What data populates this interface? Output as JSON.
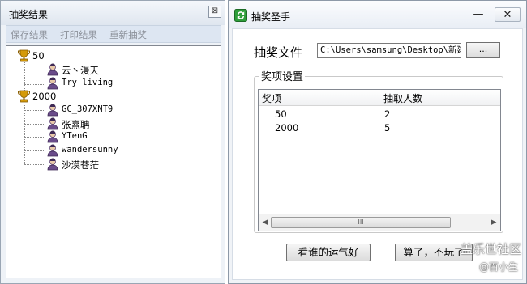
{
  "results_window": {
    "title": "抽奖结果",
    "close_glyph": "⊠",
    "menu": [
      "保存结果",
      "打印结果",
      "重新抽奖"
    ],
    "tree": [
      {
        "label": "50",
        "winners": [
          "云丶漫天",
          "Try_living_"
        ]
      },
      {
        "label": "2000",
        "winners": [
          "GC_307XNT9",
          "张熹聃",
          "YTenG",
          "wandersunny",
          "沙漠苍茫"
        ]
      }
    ],
    "icons": {
      "prize": "trophy-icon",
      "winner": "user-icon"
    }
  },
  "main_window": {
    "title": "抽奖圣手",
    "minimize_glyph": "—",
    "close_glyph": "✕",
    "file_label": "抽奖文件",
    "file_path": "C:\\Users\\samsung\\Desktop\\新建",
    "browse_label": "...",
    "settings_group": "奖项设置",
    "columns": [
      "奖项",
      "抽取人数"
    ],
    "rows": [
      {
        "prize": "50",
        "count": "2"
      },
      {
        "prize": "2000",
        "count": "5"
      }
    ],
    "scroll_left": "◀",
    "scroll_right": "▶",
    "scroll_grip": "III",
    "lucky_button": "看谁的运气好",
    "quit_button": "算了，不玩了"
  },
  "watermark": {
    "line1": "盖乐世社区",
    "line2": "@百小生"
  },
  "colors": {
    "app_icon": "#2e9e3a",
    "trophy": "#d49a0a",
    "user": "#6a4c8a"
  }
}
